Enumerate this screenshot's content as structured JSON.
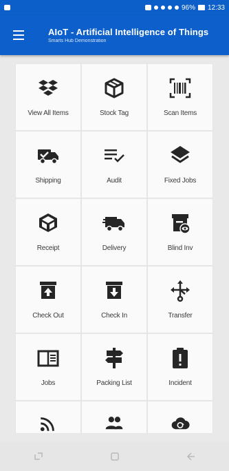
{
  "status_bar": {
    "battery": "96%",
    "time": "12:33"
  },
  "app_bar": {
    "title": "AIoT - Artificial Intelligence of Things",
    "subtitle": "Smarts Hub Demonstration",
    "menu_icon": "hamburger-menu-icon"
  },
  "tiles": [
    {
      "label": "View All Items",
      "icon": "dropbox-icon"
    },
    {
      "label": "Stock Tag",
      "icon": "cube-icon"
    },
    {
      "label": "Scan Items",
      "icon": "barcode-scan-icon"
    },
    {
      "label": "Shipping",
      "icon": "truck-check-icon"
    },
    {
      "label": "Audit",
      "icon": "list-check-icon"
    },
    {
      "label": "Fixed Jobs",
      "icon": "layers-icon"
    },
    {
      "label": "Receipt",
      "icon": "package-receive-icon"
    },
    {
      "label": "Delivery",
      "icon": "delivery-truck-icon"
    },
    {
      "label": "Blind Inv",
      "icon": "blind-inventory-icon"
    },
    {
      "label": "Check Out",
      "icon": "archive-up-icon"
    },
    {
      "label": "Check In",
      "icon": "archive-down-icon"
    },
    {
      "label": "Transfer",
      "icon": "transfer-arrows-icon"
    },
    {
      "label": "Jobs",
      "icon": "book-open-icon"
    },
    {
      "label": "Packing List",
      "icon": "signpost-icon"
    },
    {
      "label": "Incident",
      "icon": "clipboard-alert-icon"
    },
    {
      "label": "",
      "icon": "rss-icon"
    },
    {
      "label": "",
      "icon": "people-icon"
    },
    {
      "label": "",
      "icon": "cloud-sync-icon"
    }
  ],
  "nav_bar": {
    "recent": "recent-apps-icon",
    "home": "home-icon",
    "back": "back-icon"
  },
  "colors": {
    "primary": "#0d5fcb",
    "icon": "#262626",
    "tile_bg": "#fafafa",
    "page_bg": "#e9e9e9"
  }
}
